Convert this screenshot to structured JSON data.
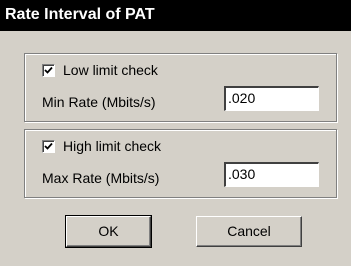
{
  "window": {
    "title": "Rate Interval of  PAT"
  },
  "low_limit": {
    "checkbox_label": "Low limit check",
    "checked": true,
    "field_label": "Min  Rate (Mbits/s)",
    "field_value": ".020"
  },
  "high_limit": {
    "checkbox_label": "High limit check",
    "checked": true,
    "field_label": "Max Rate (Mbits/s)",
    "field_value": ".030"
  },
  "buttons": {
    "ok": "OK",
    "cancel": "Cancel"
  },
  "colors": {
    "face": "#d4d0c8",
    "title_bar": "#000000",
    "title_text": "#ffffff"
  }
}
